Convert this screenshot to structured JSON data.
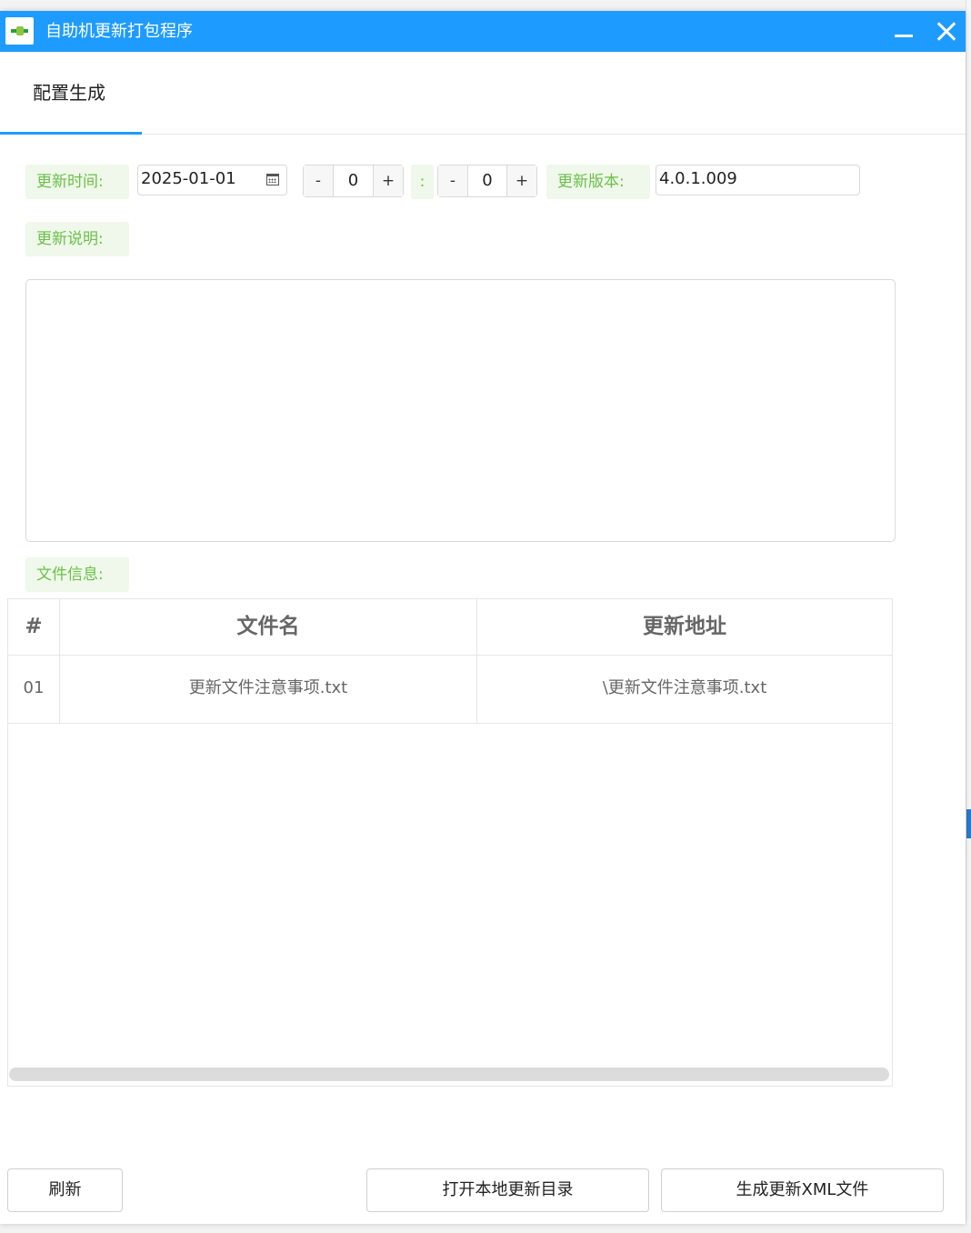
{
  "window": {
    "title": "自助机更新打包程序"
  },
  "tabs": [
    {
      "label": "配置生成",
      "active": true
    }
  ],
  "form": {
    "update_time_label": "更新时间:",
    "date_value": "2025-01-01",
    "hour": {
      "minus": "-",
      "value": "0",
      "plus": "+"
    },
    "colon": ":",
    "minute": {
      "minus": "-",
      "value": "0",
      "plus": "+"
    },
    "version_label": "更新版本:",
    "version_value": "4.0.1.009",
    "notes_label": "更新说明:",
    "notes_value": "",
    "files_label": "文件信息:"
  },
  "table": {
    "headers": [
      "#",
      "文件名",
      "更新地址"
    ],
    "rows": [
      {
        "index": "01",
        "file_name": "更新文件注意事项.txt",
        "address": "\\更新文件注意事项.txt"
      }
    ]
  },
  "buttons": {
    "refresh": "刷新",
    "open_dir": "打开本地更新目录",
    "generate_xml": "生成更新XML文件"
  },
  "colors": {
    "accent": "#1e9bff",
    "label_green": "#6cc04a",
    "label_bg": "#eff8ea"
  }
}
